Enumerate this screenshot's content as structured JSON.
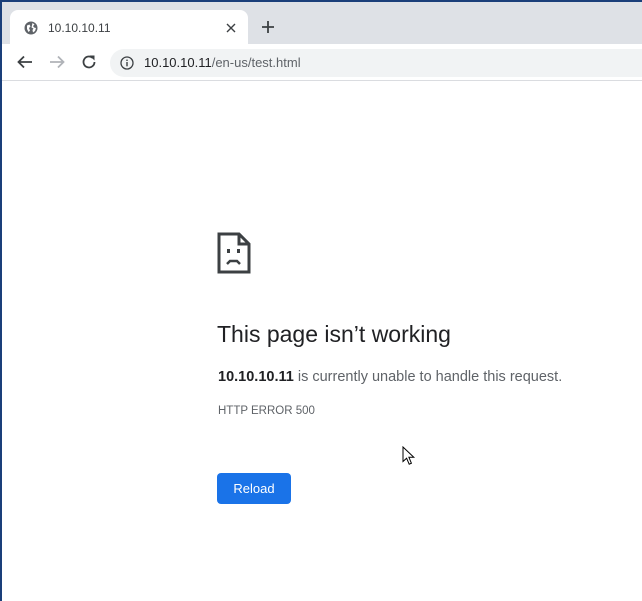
{
  "tab": {
    "title": "10.10.10.11",
    "favicon": "globe-icon"
  },
  "toolbar": {
    "url_host": "10.10.10.11",
    "url_path": "/en-us/test.html"
  },
  "error": {
    "icon": "sad-page-icon",
    "heading": "This page isn’t working",
    "host": "10.10.10.11",
    "message_rest": " is currently unable to handle this request.",
    "code": "HTTP ERROR 500",
    "reload_label": "Reload"
  },
  "colors": {
    "accent": "#1a73e8",
    "tabstrip": "#dee1e6",
    "omnibox": "#f1f3f4"
  }
}
